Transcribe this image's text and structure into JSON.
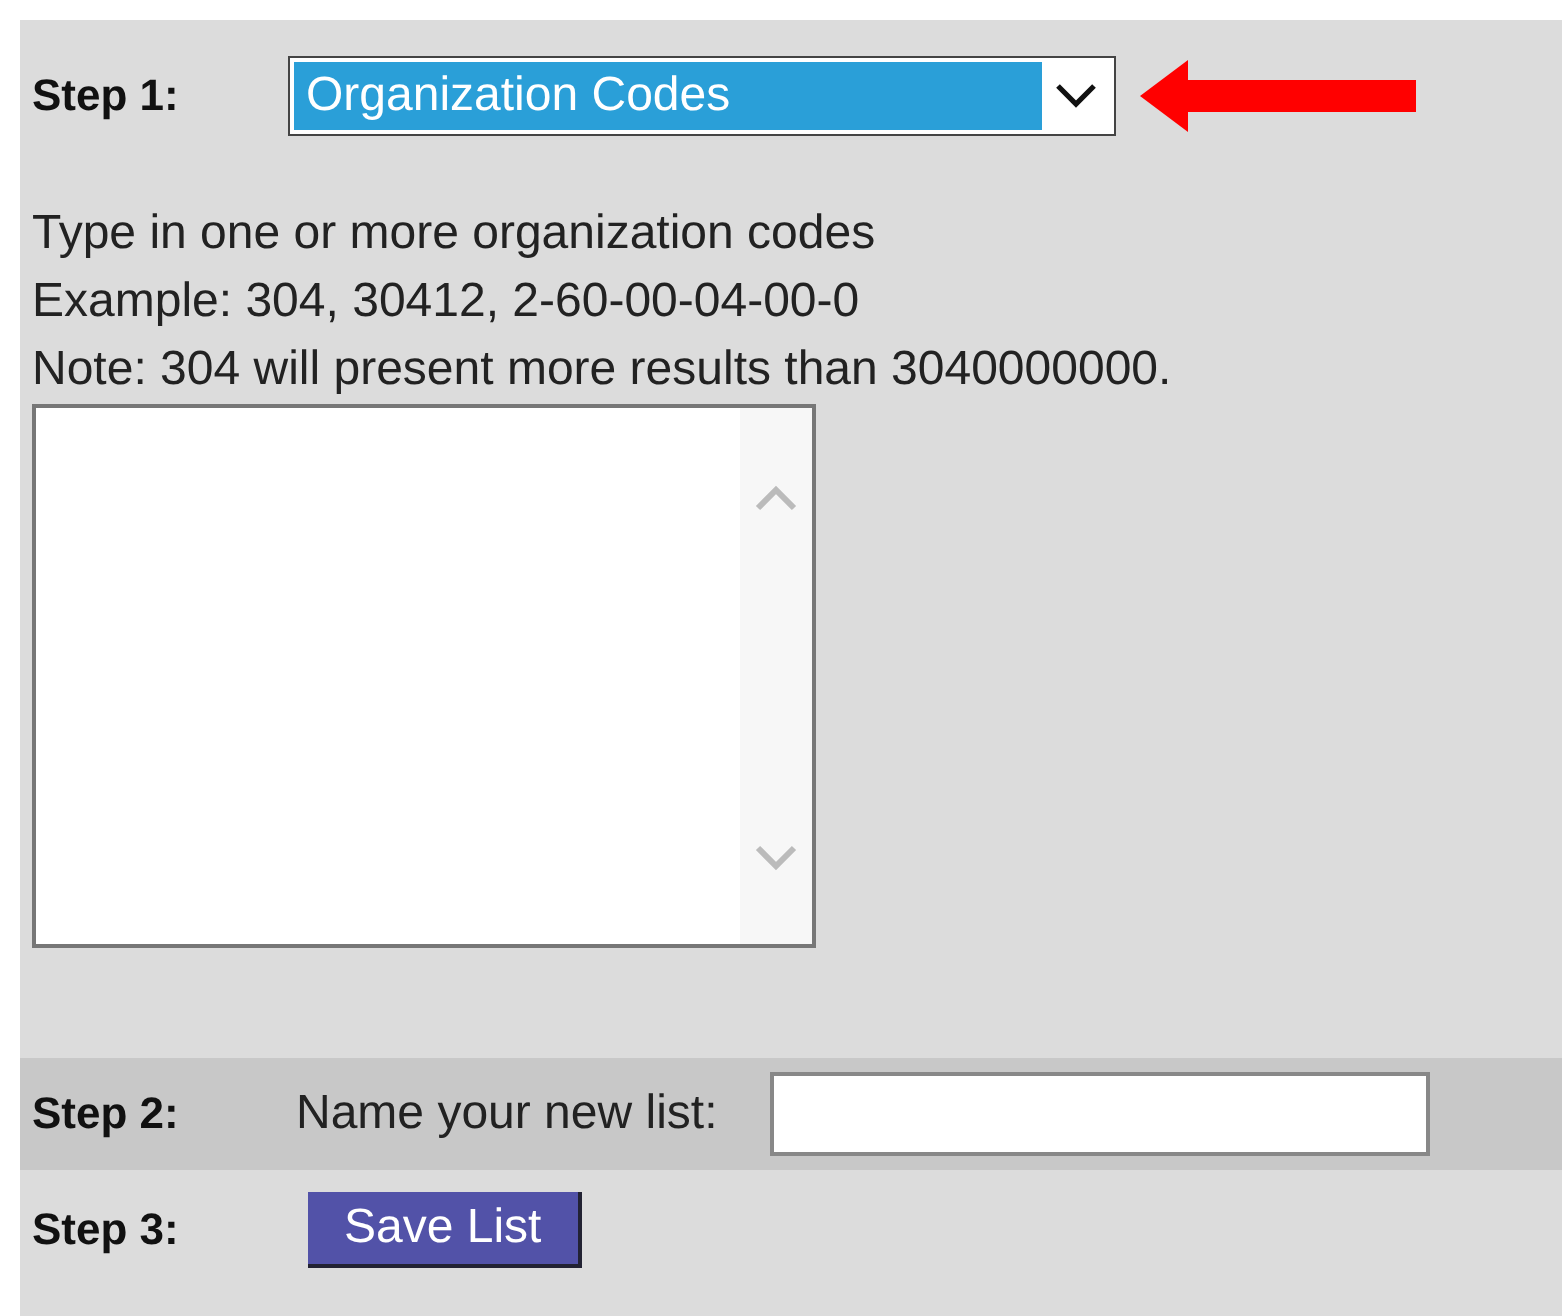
{
  "step1": {
    "label": "Step 1:",
    "dropdown": {
      "value": "Organization Codes",
      "highlighted": true
    }
  },
  "instructions": [
    "Type in one or more organization codes",
    "Example: 304, 30412, 2-60-00-04-00-0",
    "Note: 304 will present more results than 3040000000."
  ],
  "step2": {
    "label": "Step 2:",
    "prompt": "Name your new list:"
  },
  "step3": {
    "label": "Step 3:",
    "button": "Save List"
  }
}
